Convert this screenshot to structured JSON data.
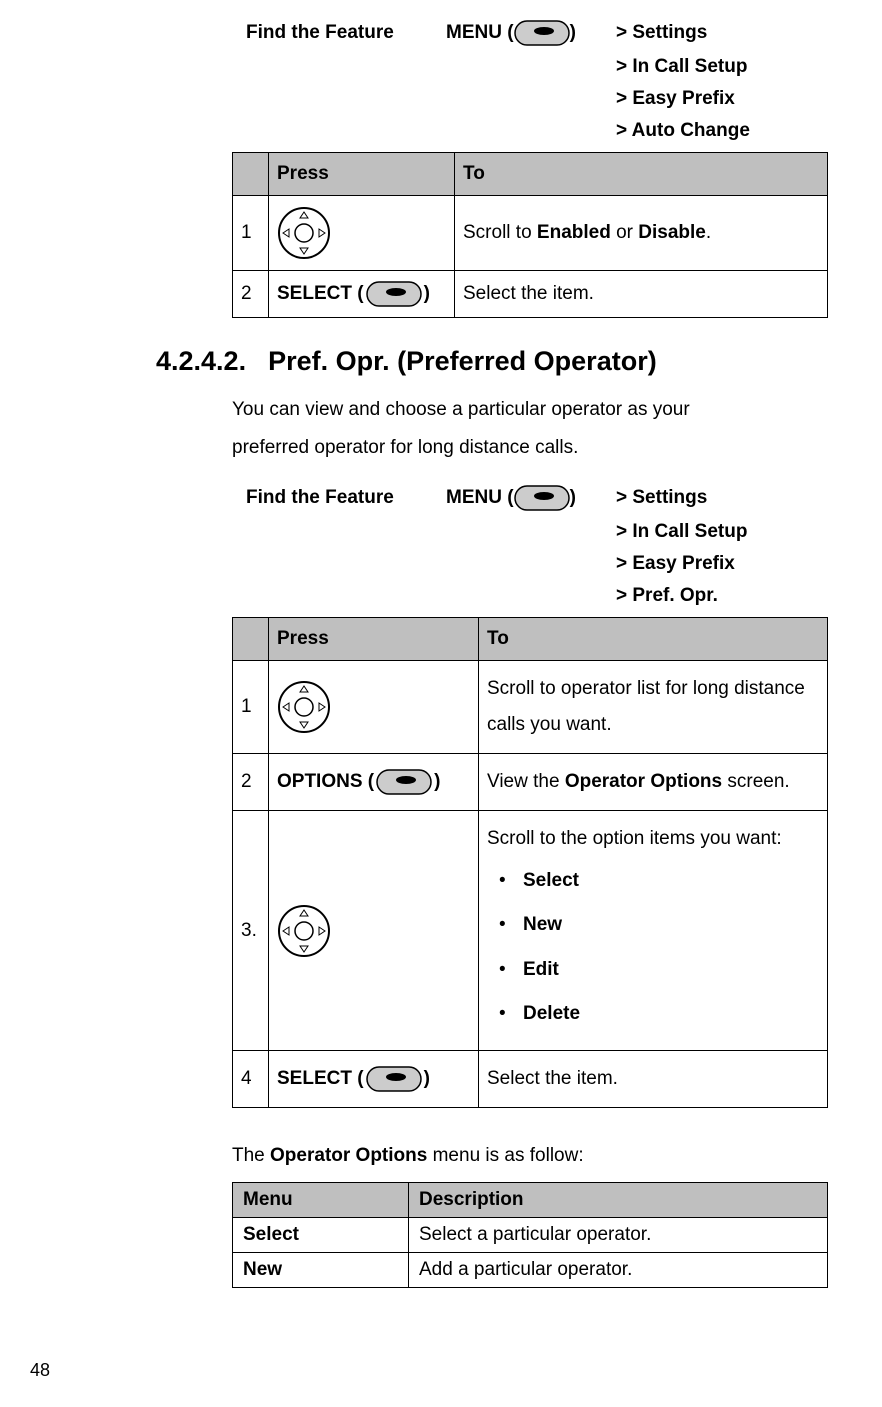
{
  "feature1": {
    "find_label": "Find the Feature",
    "menu_label": "MENU (",
    "menu_close": ")",
    "crumbs": [
      "> Settings",
      "> In Call Setup",
      "> Easy Prefix",
      "> Auto Change"
    ]
  },
  "table1": {
    "head_press": "Press",
    "head_to": "To",
    "rows": [
      {
        "num": "1",
        "press_kind": "nav",
        "to": "Scroll to <b>Enabled</b> or <b>Disable</b>."
      },
      {
        "num": "2",
        "press_kind": "soft",
        "press_label": "SELECT (",
        "press_close": ")",
        "to": "Select the item."
      }
    ]
  },
  "section": {
    "num": "4.2.4.2.",
    "title": "Pref. Opr. (Preferred Operator)",
    "body": "You can view and choose a particular operator as your preferred operator for long distance calls."
  },
  "feature2": {
    "find_label": "Find the Feature",
    "menu_label": "MENU (",
    "menu_close": ")",
    "crumbs": [
      "> Settings",
      "> In Call Setup",
      "> Easy Prefix",
      "> Pref. Opr."
    ]
  },
  "table2": {
    "head_press": "Press",
    "head_to": "To",
    "rows": [
      {
        "num": "1",
        "press_kind": "nav",
        "to": "Scroll to operator list for long distance calls you want."
      },
      {
        "num": "2",
        "press_kind": "soft",
        "press_label": "OPTIONS (",
        "press_close": ")",
        "to": "View the <b>Operator Options</b> screen."
      },
      {
        "num": "3.",
        "press_kind": "nav",
        "to_lead": "Scroll to the option items you want:",
        "to_list": [
          "Select",
          "New",
          "Edit",
          "Delete"
        ]
      },
      {
        "num": "4",
        "press_kind": "soft",
        "press_label": "SELECT (",
        "press_close": ")",
        "to": "Select the item."
      }
    ]
  },
  "menu_intro": "The <b>Operator Options</b> menu is as follow:",
  "table3": {
    "head_menu": "Menu",
    "head_desc": "Description",
    "rows": [
      {
        "menu": "Select",
        "desc": "Select a particular operator."
      },
      {
        "menu": "New",
        "desc": "Add a particular operator."
      }
    ]
  },
  "page_number": "48"
}
